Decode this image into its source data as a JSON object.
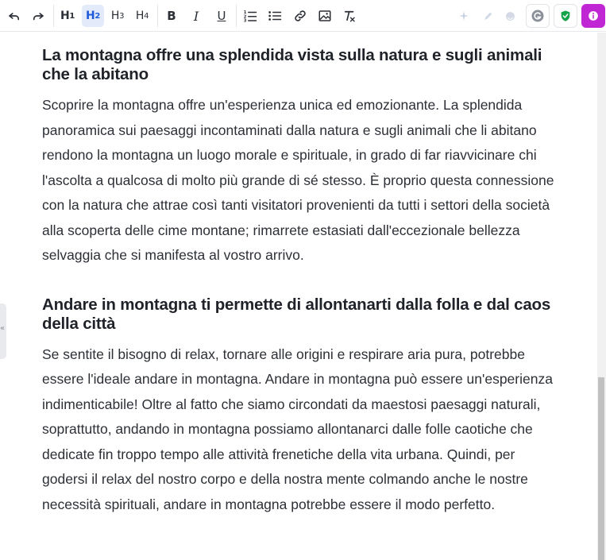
{
  "toolbar": {
    "undo_icon": "undo-icon",
    "redo_icon": "redo-icon",
    "headings": [
      {
        "label": "H",
        "level": "1"
      },
      {
        "label": "H",
        "level": "2"
      },
      {
        "label": "H",
        "level": "3"
      },
      {
        "label": "H",
        "level": "4"
      }
    ],
    "bold": "B",
    "italic": "I",
    "underline": "U",
    "accent_color": "#1f5bd8",
    "active_bg": "#e3ebfb"
  },
  "extensions": {
    "grammarly_color": "#16a34a",
    "info_color": "#c026d3"
  },
  "article": {
    "sections": [
      {
        "heading": "La montagna offre una splendida vista sulla natura e sugli animali che la abitano",
        "paragraph": "Scoprire la montagna offre un'esperienza unica ed emozionante. La splendida panoramica sui paesaggi incontaminati dalla natura e sugli animali che li abitano rendono la montagna un luogo morale e spirituale, in grado di far riavvicinare chi l'ascolta a qualcosa di molto più grande di sé stesso. È proprio questa connessione con la natura che attrae così tanti visitatori provenienti da tutti i settori della società alla scoperta delle cime montane; rimarrete estasiati dall'eccezionale bellezza selvaggia che si manifesta al vostro arrivo."
      },
      {
        "heading": "Andare in montagna ti permette di allontanarti dalla folla e dal caos della città",
        "paragraph": "Se sentite il bisogno di relax, tornare alle origini e respirare aria pura, potrebbe essere l'ideale andare in montagna. Andare in montagna può essere un'esperienza indimenticabile! Oltre al fatto che siamo circondati da maestosi paesaggi naturali, soprattutto, andando in montagna possiamo allontanarci dalle folle caotiche che dedicate fin troppo tempo alle attività frenetiche della vita urbana. Quindi, per godersi il relax del nostro corpo e della nostra mente colmando anche le nostre necessità spirituali, andare in montagna potrebbe essere il modo perfetto."
      }
    ]
  },
  "side_handle": {
    "glyph": "«"
  }
}
